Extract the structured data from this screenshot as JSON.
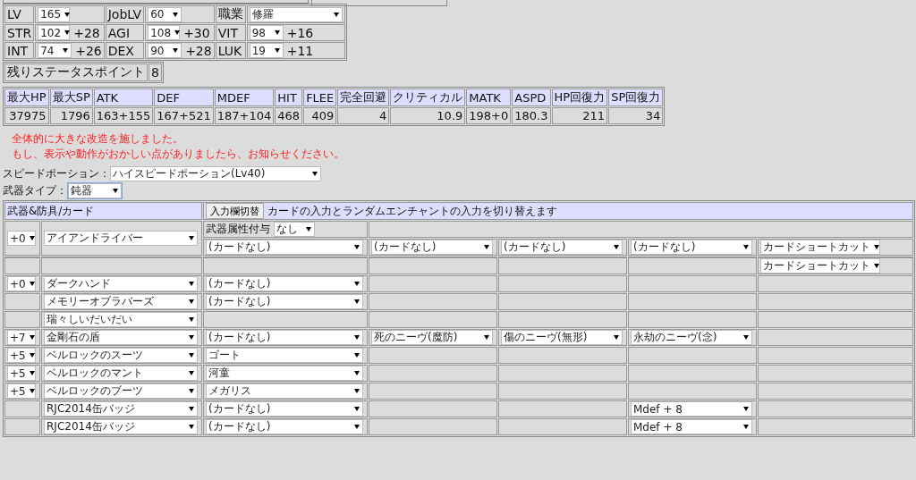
{
  "base_stats": [
    [
      {
        "label": "LV",
        "value": "165"
      },
      {
        "label": "JobLV",
        "value": "60"
      },
      {
        "label": "職業",
        "value": "修羅"
      }
    ],
    [
      {
        "label": "STR",
        "value": "102",
        "bonus": "+28"
      },
      {
        "label": "AGI",
        "value": "108",
        "bonus": "+30"
      },
      {
        "label": "VIT",
        "value": "98",
        "bonus": "+16"
      }
    ],
    [
      {
        "label": "INT",
        "value": "74",
        "bonus": "+26"
      },
      {
        "label": "DEX",
        "value": "90",
        "bonus": "+28"
      },
      {
        "label": "LUK",
        "value": "19",
        "bonus": "+11"
      }
    ]
  ],
  "remaining_points": {
    "label": "残りステータスポイント",
    "value": "8"
  },
  "status_table": {
    "columns": [
      "最大HP",
      "最大SP",
      "ATK",
      "DEF",
      "MDEF",
      "HIT",
      "FLEE",
      "完全回避",
      "クリティカル",
      "MATK",
      "ASPD",
      "HP回復力",
      "SP回復力"
    ],
    "values": [
      "37975",
      "1796",
      "163+155",
      "167+521",
      "187+104",
      "468",
      "409",
      "4",
      "10.9",
      "198+0",
      "180.3",
      "211",
      "34"
    ]
  },
  "notice": [
    "全体的に大きな改造を施しました。",
    "もし、表示や動作がおかしい点がありましたら、お知らせください。"
  ],
  "speed_potion": {
    "label": "スピードポーション：",
    "value": "ハイスピードポーション(Lv40)"
  },
  "weapon_type": {
    "label": "武器タイプ：",
    "value": "鈍器"
  },
  "equipment": {
    "title": "武器&防具/カード",
    "toggle_button": "入力欄切替",
    "description": "カードの入力とランダムエンチャントの入力を切り替えます",
    "weapon": {
      "refine": "+0",
      "item": "アイアンドライバー",
      "element_label": "武器属性付与",
      "element": "なし",
      "slot_1": "(カードなし)",
      "slot_2": "(カードなし)",
      "slot_3": "(カードなし)",
      "slot_4": "(カードなし)",
      "slot_5": "カードショートカット"
    },
    "shortcut_row": {
      "slot_5": "カードショートカット"
    },
    "rows": [
      {
        "refine": "+0",
        "item": "ダークハンド",
        "slot_1": "(カードなし)"
      },
      {
        "item": "メモリーオブラバーズ",
        "slot_1": "(カードなし)"
      },
      {
        "item": "瑞々しいだいだい"
      },
      {
        "refine": "+7",
        "item": "金剛石の盾",
        "slot_1": "(カードなし)",
        "slot_2": "死のニーヴ(魔防)",
        "slot_3": "傷のニーヴ(無形)",
        "slot_4": "永劫のニーヴ(念)"
      },
      {
        "refine": "+5",
        "item": "ベルロックのスーツ",
        "slot_1": "ゴート"
      },
      {
        "refine": "+5",
        "item": "ベルロックのマント",
        "slot_1": "河童"
      },
      {
        "refine": "+5",
        "item": "ベルロックのブーツ",
        "slot_1": "メガリス"
      },
      {
        "item": "RJC2014缶バッジ",
        "slot_1": "(カードなし)",
        "slot_4": "Mdef + 8"
      },
      {
        "item": "RJC2014缶バッジ",
        "slot_1": "(カードなし)",
        "slot_4": "Mdef + 8"
      }
    ]
  }
}
